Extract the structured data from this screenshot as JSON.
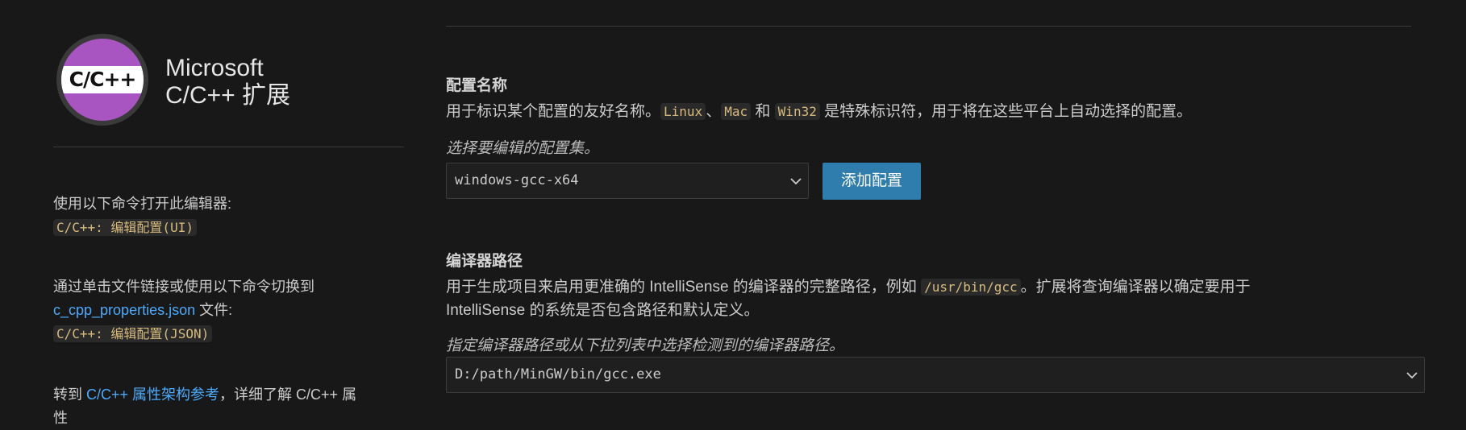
{
  "sidebar": {
    "logo_text": "C/C++",
    "ext_line1": "Microsoft",
    "ext_line2": "C/C++ 扩展",
    "block1_text": "使用以下命令打开此编辑器:",
    "block1_cmd": "C/C++: 编辑配置(UI)",
    "block2_line1": "通过单击文件链接或使用以下命令切换到",
    "block2_link": "c_cpp_properties.json",
    "block2_suffix": " 文件:",
    "block2_cmd": "C/C++: 编辑配置(JSON)",
    "block3_prefix": "转到 ",
    "block3_link": "C/C++ 属性架构参考",
    "block3_suffix": "，详细了解 C/C++ 属",
    "block3_line2": "性"
  },
  "config_name": {
    "title": "配置名称",
    "desc_part1": "用于标识某个配置的友好名称。",
    "code_linux": "Linux",
    "sep1": "、",
    "code_mac": "Mac",
    "sep2": " 和 ",
    "code_win32": "Win32",
    "desc_part2": " 是特殊标识符，用于将在这些平台上自动选择的配置。",
    "hint": "选择要编辑的配置集。",
    "selected": "windows-gcc-x64",
    "add_button": "添加配置"
  },
  "compiler_path": {
    "title": "编译器路径",
    "desc_part1": "用于生成项目来启用更准确的 IntelliSense 的编译器的完整路径，例如 ",
    "code_example": "/usr/bin/gcc",
    "desc_part2": "。扩展将查询编译器以确定要用于",
    "desc_line2": "IntelliSense 的系统是否包含路径和默认定义。",
    "hint": "指定编译器路径或从下拉列表中选择检测到的编译器路径。",
    "value": "D:/path/MinGW/bin/gcc.exe"
  }
}
